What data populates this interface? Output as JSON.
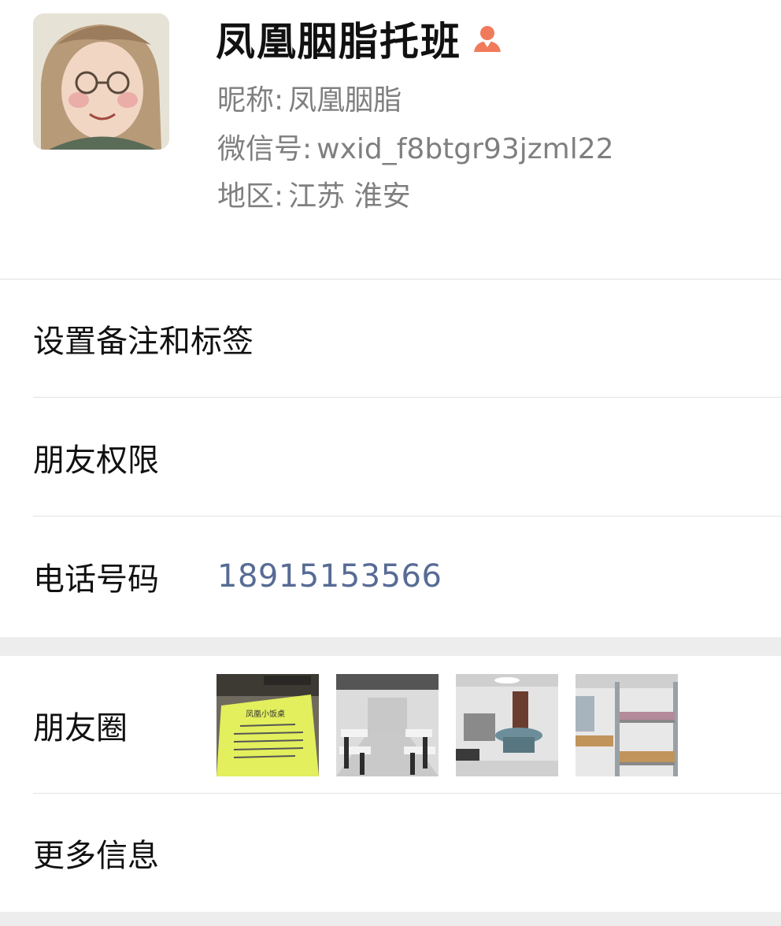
{
  "profile": {
    "name": "凤凰胭脂托班",
    "gender_icon": "female-gender-icon",
    "gender_color": "#f07b5b",
    "nickname_label": "昵称:",
    "nickname": "凤凰胭脂",
    "wxid_label": "微信号:",
    "wxid": "wxid_f8btgr93jzml22",
    "region_label": "地区:",
    "region": "江苏 淮安"
  },
  "menu": {
    "remark_tags": "设置备注和标签",
    "friend_permission": "朋友权限",
    "phone_label": "电话号码",
    "phone_value": "18915153566",
    "moments_label": "朋友圈",
    "more_info": "更多信息"
  },
  "moments_thumbnails": [
    {
      "name": "moments-photo-flyer",
      "caption": "凤凰小饭桌"
    },
    {
      "name": "moments-photo-dining-room"
    },
    {
      "name": "moments-photo-room-table"
    },
    {
      "name": "moments-photo-bunk-beds"
    }
  ],
  "colors": {
    "link_blue": "#576b95",
    "secondary_text": "#7f7f7f",
    "background": "#ededed"
  }
}
